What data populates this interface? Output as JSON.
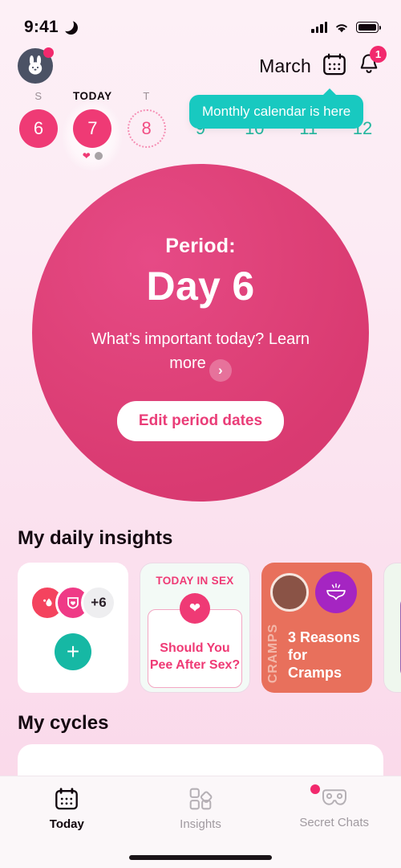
{
  "status_bar": {
    "time": "9:41",
    "moon_icon": "moon-icon",
    "signal_icon": "signal-bars-icon",
    "wifi_icon": "wifi-icon",
    "battery_icon": "battery-icon"
  },
  "header": {
    "avatar": "bunny-avatar",
    "avatar_badge": "notification-dot",
    "month": "March",
    "calendar_icon": "calendar-icon",
    "bell_icon": "bell-icon",
    "bell_badge": "1"
  },
  "tooltip": {
    "text": "Monthly calendar is here",
    "color": "#18c9c0"
  },
  "day_strip": {
    "days": [
      {
        "label": "S",
        "number": "6",
        "style": "filled"
      },
      {
        "label": "TODAY",
        "number": "7",
        "style": "today"
      },
      {
        "label": "T",
        "number": "8",
        "style": "dotted"
      },
      {
        "label": "",
        "number": "9",
        "style": "plain"
      },
      {
        "label": "",
        "number": "10",
        "style": "plain"
      },
      {
        "label": "",
        "number": "11",
        "style": "plain"
      },
      {
        "label": "",
        "number": "12",
        "style": "plain"
      }
    ],
    "today_marks": [
      "heart-mark",
      "dot-mark"
    ]
  },
  "hero": {
    "eyebrow": "Period:",
    "day": "Day 6",
    "learn_more": "What’s important today? Learn more",
    "chevron_icon": "chevron-right-icon",
    "edit_button": "Edit period dates",
    "accent": "#df4279"
  },
  "insights": {
    "title": "My daily insights",
    "cards": [
      {
        "type": "symptoms",
        "symptom_icons": [
          "blood-drop-icon",
          "shield-heart-icon"
        ],
        "more_count": "+6",
        "add_button": "+"
      },
      {
        "type": "sex",
        "kicker": "TODAY IN SEX",
        "heart_icon": "heart-icon",
        "headline": "Should You Pee After Sex?"
      },
      {
        "type": "cramps",
        "photo_icon": "avatar-photo",
        "symbol_icon": "underwear-icon",
        "vertical_label": "CRAMPS",
        "headline": "3 Reasons for Cramps",
        "color": "#e8705c"
      },
      {
        "type": "mint",
        "color": "#eff7ee"
      }
    ]
  },
  "cycles": {
    "title": "My cycles"
  },
  "tabbar": {
    "tabs": [
      {
        "label": "Today",
        "icon": "calendar-icon",
        "active": true,
        "badge": false
      },
      {
        "label": "Insights",
        "icon": "grid-icon",
        "active": false,
        "badge": false
      },
      {
        "label": "Secret Chats",
        "icon": "mask-icon",
        "active": false,
        "badge": true
      }
    ]
  }
}
